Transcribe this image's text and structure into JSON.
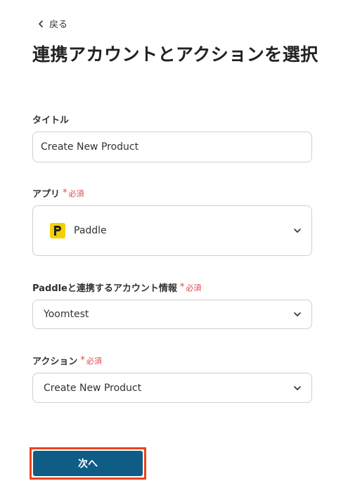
{
  "nav": {
    "back_label": "戻る"
  },
  "page": {
    "title": "連携アカウントとアクションを選択"
  },
  "required_label": "必須",
  "fields": {
    "title": {
      "label": "タイトル",
      "value": "Create New Product"
    },
    "app": {
      "label": "アプリ",
      "value": "Paddle",
      "logo_letter": "P"
    },
    "account": {
      "label": "Paddleと連携するアカウント情報",
      "value": "Yoomtest"
    },
    "action": {
      "label": "アクション",
      "value": "Create New Product"
    }
  },
  "footer": {
    "next_label": "次へ"
  },
  "colors": {
    "primary": "#0f5d86",
    "required": "#e0474f",
    "highlight": "#e8441f",
    "paddle_yellow": "#f5d000"
  }
}
